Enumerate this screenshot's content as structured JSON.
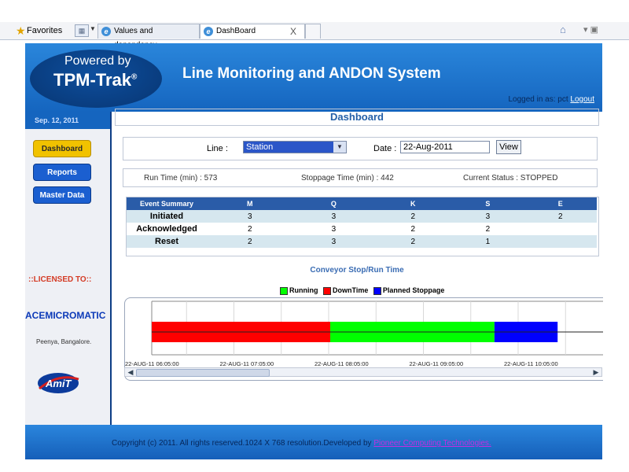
{
  "browser": {
    "favorites": "Favorites",
    "tabs": [
      {
        "label": "Values and dependency."
      },
      {
        "label": "DashBoard",
        "close": "X"
      }
    ]
  },
  "header": {
    "powered_by": "Powered by",
    "brand": "TPM-Trak",
    "brand_mark": "®",
    "app_title": "Line Monitoring and ANDON System",
    "logged_in": "Logged in as: pct",
    "logout": "Logout"
  },
  "sidebar": {
    "date": "Sep. 12, 2011",
    "nav": [
      "Dashboard",
      "Reports",
      "Master Data"
    ],
    "licensed_to": "::LICENSED TO::",
    "company": "ACEMICROMATIC",
    "place": "Peenya, Bangalore.",
    "logo_text": "AmiT"
  },
  "dashboard": {
    "title": "Dashboard",
    "line_label": "Line :",
    "line_value": "Station",
    "date_label": "Date :",
    "date_value": "22-Aug-2011",
    "view_button": "View",
    "run_time": "Run Time (min) : 573",
    "stoppage_time": "Stoppage Time (min) : 442",
    "current_status": "Current Status : STOPPED"
  },
  "event_summary": {
    "headers": [
      "Event Summary",
      "M",
      "Q",
      "K",
      "S",
      "E"
    ],
    "rows": [
      [
        "Initiated",
        "3",
        "3",
        "2",
        "3",
        "2"
      ],
      [
        "Acknowledged",
        "2",
        "3",
        "2",
        "2",
        ""
      ],
      [
        "Reset",
        "2",
        "3",
        "2",
        "1",
        ""
      ]
    ]
  },
  "chart_data": {
    "type": "bar",
    "title": "Conveyor Stop/Run Time",
    "legend": [
      "Running",
      "DownTime",
      "Planned Stoppage"
    ],
    "colors": {
      "Running": "#00ff00",
      "DownTime": "#ff0000",
      "Planned Stoppage": "#0000ff"
    },
    "x_ticks": [
      "22-AUG-11 06:05:00",
      "22-AUG-11 07:05:00",
      "22-AUG-11 08:05:00",
      "22-AUG-11 09:05:00",
      "22-AUG-11 10:05:00"
    ],
    "segments": [
      {
        "state": "DownTime",
        "start": "22-AUG-11 06:13:00",
        "end": "22-AUG-11 08:06:00"
      },
      {
        "state": "Running",
        "start": "22-AUG-11 08:06:00",
        "end": "22-AUG-11 09:50:00"
      },
      {
        "state": "Planned Stoppage",
        "start": "22-AUG-11 09:50:00",
        "end": "22-AUG-11 10:30:00"
      }
    ]
  },
  "footer": {
    "text": "Copyright (c) 2011. All rights reserved.1024 X 768 resolution.Developed by",
    "link": "Pioneer Computing Technologies."
  }
}
